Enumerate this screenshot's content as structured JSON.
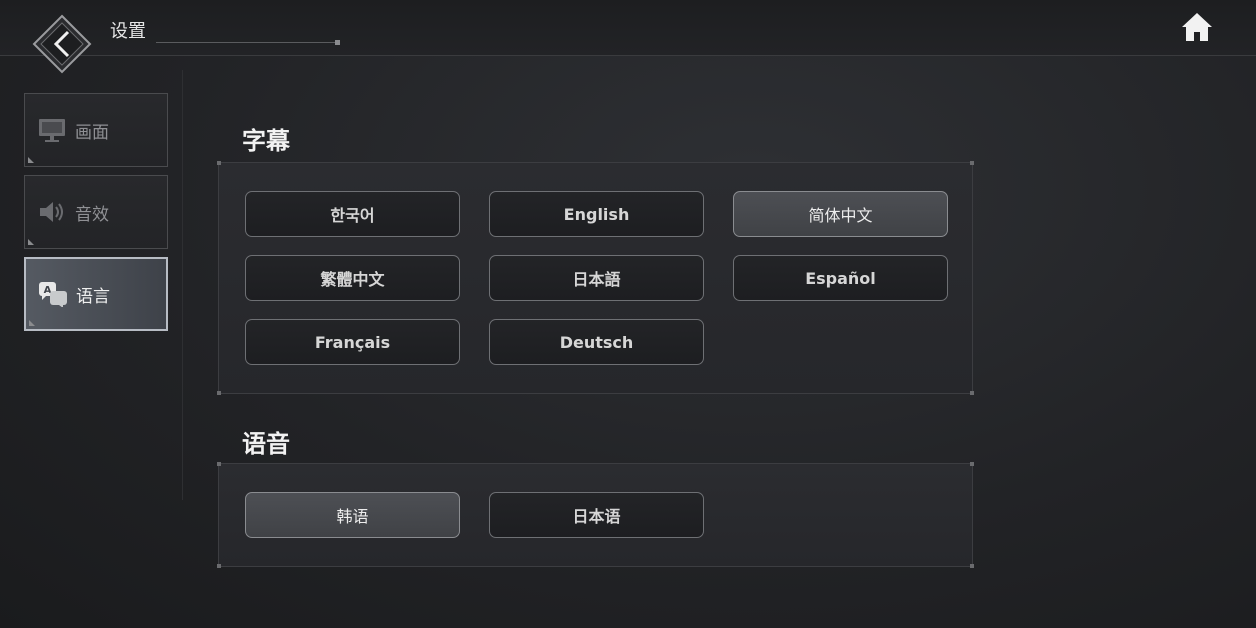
{
  "header": {
    "title": "设置",
    "back_icon": "back-chevron-icon",
    "home_icon": "home-icon"
  },
  "sidebar": {
    "items": [
      {
        "label": "画面",
        "icon": "monitor-icon",
        "active": false
      },
      {
        "label": "音效",
        "icon": "speaker-icon",
        "active": false
      },
      {
        "label": "语言",
        "icon": "translate-icon",
        "active": true
      }
    ]
  },
  "subtitles": {
    "title": "字幕",
    "options": [
      "한국어",
      "English",
      "简体中文",
      "繁體中文",
      "日本語",
      "Español",
      "Français",
      "Deutsch"
    ],
    "selected": "简体中文"
  },
  "voice": {
    "title": "语音",
    "options": [
      "韩语",
      "日本语"
    ],
    "selected": "韩语"
  },
  "colors": {
    "accent": "#b7bcc4",
    "background": "#222326",
    "selected_button": "#4d4f54"
  }
}
